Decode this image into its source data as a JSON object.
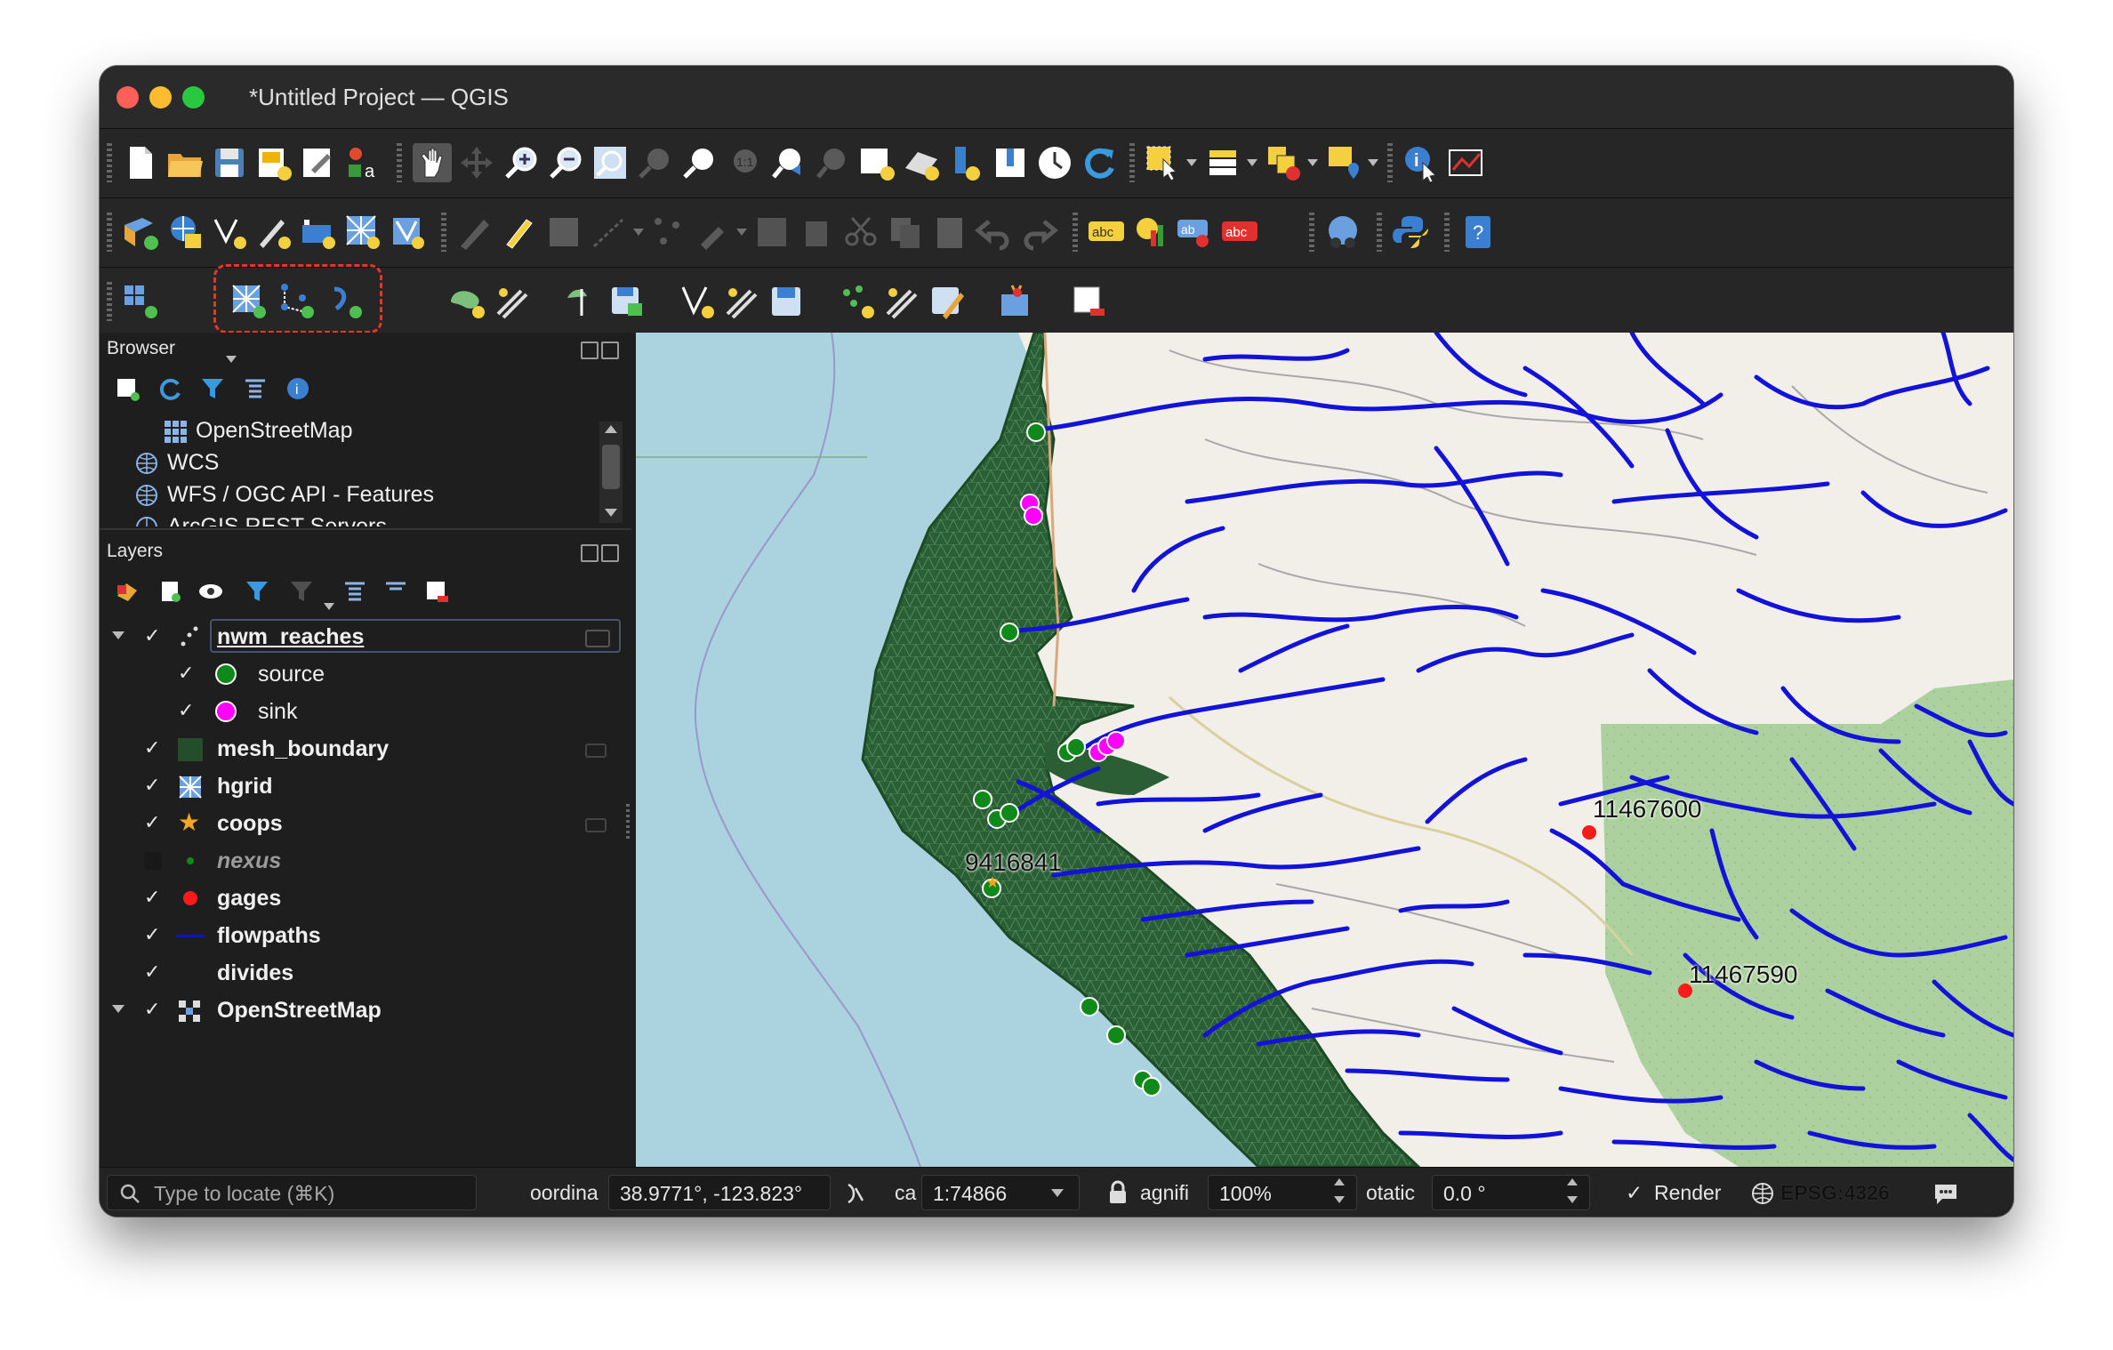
{
  "window": {
    "title": "*Untitled Project — QGIS"
  },
  "toolbars": {
    "row1": [
      "new-project-icon",
      "open-project-icon",
      "save-project-icon",
      "new-print-layout-icon",
      "layout-manager-icon",
      "style-manager-icon",
      "pan-map-icon",
      "pan-to-selection-icon",
      "zoom-in-icon",
      "zoom-out-icon",
      "zoom-full-icon",
      "zoom-to-selection-icon",
      "zoom-to-layer-icon",
      "zoom-native-icon",
      "zoom-last-icon",
      "zoom-next-icon",
      "new-map-view-icon",
      "new-3d-map-icon",
      "new-bookmark-icon",
      "show-bookmarks-icon",
      "temporal-controller-icon",
      "refresh-icon",
      "select-features-icon",
      "open-attribute-table-icon",
      "deselect-features-icon",
      "select-by-location-icon",
      "identify-features-icon",
      "measure-icon"
    ],
    "row2": [
      "data-source-manager-icon",
      "new-geopackage-layer-icon",
      "new-shapefile-layer-icon",
      "new-temporary-layer-icon",
      "new-virtual-layer-icon",
      "new-mesh-layer-icon",
      "new-vector-tile-icon",
      "digitize-icon",
      "toggle-editing-icon",
      "save-edits-icon",
      "add-feature-icon",
      "vertex-tool-icon",
      "edit-table-icon",
      "delete-icon",
      "cut-icon",
      "copy-icon",
      "paste-icon",
      "undo-icon",
      "redo-icon",
      "label-icon",
      "diagram-icon",
      "pin-label-icon",
      "show-labels-icon",
      "metasearch-icon",
      "python-console-icon",
      "help-icon"
    ],
    "row3": [
      "mesh-tools-icon",
      "add-mesh-layer-icon",
      "add-point-layer-icon",
      "add-line-layer-icon",
      "plugin-tool-icon"
    ],
    "highlighted_group": [
      "add-mesh-layer-icon",
      "add-point-layer-icon",
      "add-line-layer-icon"
    ]
  },
  "browser": {
    "title": "Browser",
    "items": [
      {
        "label": "OpenStreetMap",
        "icon": "grid-icon"
      },
      {
        "label": "WCS",
        "icon": "globe-icon"
      },
      {
        "label": "WFS / OGC API - Features",
        "icon": "globe-icon"
      },
      {
        "label": "ArcGIS REST Servers",
        "icon": "globe-icon"
      }
    ]
  },
  "layers": {
    "title": "Layers",
    "items": [
      {
        "label": "nwm_reaches",
        "checked": "✓",
        "expanded": true,
        "selected": true
      },
      {
        "label": "source",
        "checked": "✓",
        "swatch": "#0f8a1a"
      },
      {
        "label": "sink",
        "checked": "✓",
        "swatch": "#ff00ff"
      },
      {
        "label": "mesh_boundary",
        "checked": "✓",
        "swatch": "#234d2b"
      },
      {
        "label": "hgrid",
        "checked": "✓"
      },
      {
        "label": "coops",
        "checked": "✓",
        "swatch": "#f5a623"
      },
      {
        "label": "nexus",
        "checked": "",
        "swatch": "#0f8a1a"
      },
      {
        "label": "gages",
        "checked": "✓",
        "swatch": "#ff1a1a"
      },
      {
        "label": "flowpaths",
        "checked": "✓",
        "swatch": "#1010d0"
      },
      {
        "label": "divides",
        "checked": "✓"
      },
      {
        "label": "OpenStreetMap",
        "checked": "✓",
        "expanded": true
      }
    ]
  },
  "map": {
    "labels": {
      "gage1": "11467600",
      "gage2": "11467590",
      "coops": "9416841"
    },
    "colors": {
      "ocean": "#aad3df",
      "land": "#f2efe9",
      "forest": "#add19e",
      "mesh": "#2c5e36",
      "flowpath": "#1212d8",
      "source": "#0f8a1a",
      "sink": "#ff00ff",
      "gage": "#ff1a1a"
    }
  },
  "statusbar": {
    "locate_placeholder": "Type to locate (⌘K)",
    "coordinate_label": "oordina",
    "coordinate_value": "38.9771°, -123.823°",
    "scale_label": "ca",
    "scale_value": "1:74866",
    "magnifier_label": "agnifi",
    "magnifier_value": "100%",
    "rotation_label": "otatic",
    "rotation_value": "0.0 °",
    "render_check": "✓",
    "render_label": "Render",
    "crs": "EPSG:4326"
  }
}
